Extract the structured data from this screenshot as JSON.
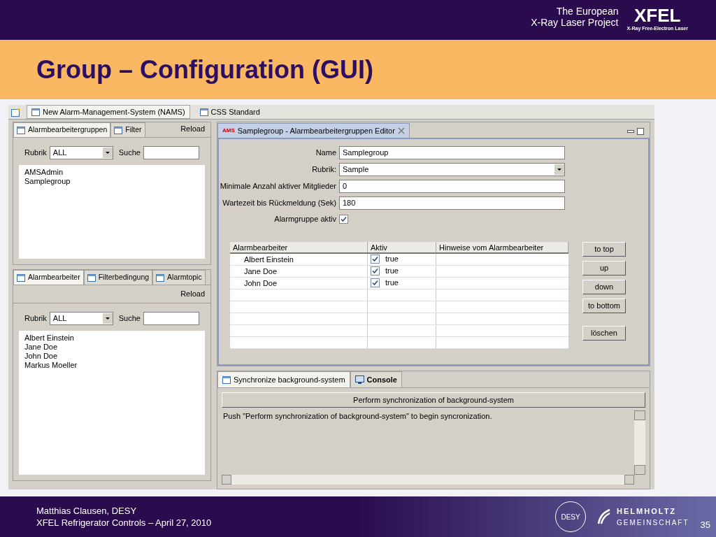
{
  "header": {
    "org_lines": [
      "The European",
      "X-Ray Laser Project"
    ],
    "logo": "XFEL",
    "logo_subtitle": "X-Ray Free-Electron Laser"
  },
  "title": "Group – Configuration (GUI)",
  "app": {
    "top_tabs": [
      {
        "label": "New Alarm-Management-System (NAMS)",
        "selected": true
      },
      {
        "label": "CSS Standard",
        "selected": false
      }
    ],
    "groups_panel": {
      "tabs": [
        {
          "label": "Alarmbearbeitergruppen",
          "selected": true
        },
        {
          "label": "Filter",
          "selected": false
        }
      ],
      "reload": "Reload",
      "rubrik_label": "Rubrik",
      "rubrik_value": "ALL",
      "search_label": "Suche",
      "items": [
        "AMSAdmin",
        "Samplegroup"
      ]
    },
    "workers_panel": {
      "tabs": [
        {
          "label": "Alarmbearbeiter",
          "selected": true
        },
        {
          "label": "Filterbedingung",
          "selected": false
        },
        {
          "label": "Alarmtopic",
          "selected": false
        }
      ],
      "reload": "Reload",
      "rubrik_label": "Rubrik",
      "rubrik_value": "ALL",
      "search_label": "Suche",
      "items": [
        "Albert Einstein",
        "Jane Doe",
        "John Doe",
        "Markus Moeller"
      ]
    },
    "editor": {
      "tab_badge": "AMS",
      "tab_title": "Samplegroup - Alarmbearbeitergruppen Editor",
      "fields": [
        {
          "label": "Name",
          "value": "Samplegroup",
          "kind": "text"
        },
        {
          "label": "Rubrik:",
          "value": "Sample",
          "kind": "dropdown"
        },
        {
          "label": "Minimale Anzahl aktiver Mitglieder",
          "value": "0",
          "kind": "text"
        },
        {
          "label": "Wartezeit bis Rückmeldung (Sek)",
          "value": "180",
          "kind": "text"
        }
      ],
      "active": {
        "label": "Alarmgruppe aktiv",
        "checked": true
      },
      "table": {
        "columns": [
          "Alarmbearbeiter",
          "Aktiv",
          "Hinweise vom Alarmbearbeiter"
        ],
        "rows": [
          {
            "name": "Albert Einstein",
            "checked": true,
            "aktiv": "true"
          },
          {
            "name": "Jane Doe",
            "checked": true,
            "aktiv": "true"
          },
          {
            "name": "John Doe",
            "checked": true,
            "aktiv": "true"
          }
        ]
      },
      "buttons": [
        "to top",
        "up",
        "down",
        "to bottom",
        "löschen"
      ]
    },
    "sync_panel": {
      "tabs": [
        {
          "label": "Synchronize background-system",
          "selected": true
        },
        {
          "label": "Console",
          "selected": false
        }
      ],
      "button": "Perform synchronization of background-system",
      "message": "Push \"Perform synchronization of background-system\" to begin syncronization."
    }
  },
  "footer": {
    "lines": [
      "Matthias Clausen, DESY",
      "XFEL Refrigerator Controls – April 27, 2010"
    ],
    "desy_logo": "DESY",
    "helmholtz": [
      "HELMHOLTZ",
      "GEMEINSCHAFT"
    ],
    "page": "35"
  }
}
